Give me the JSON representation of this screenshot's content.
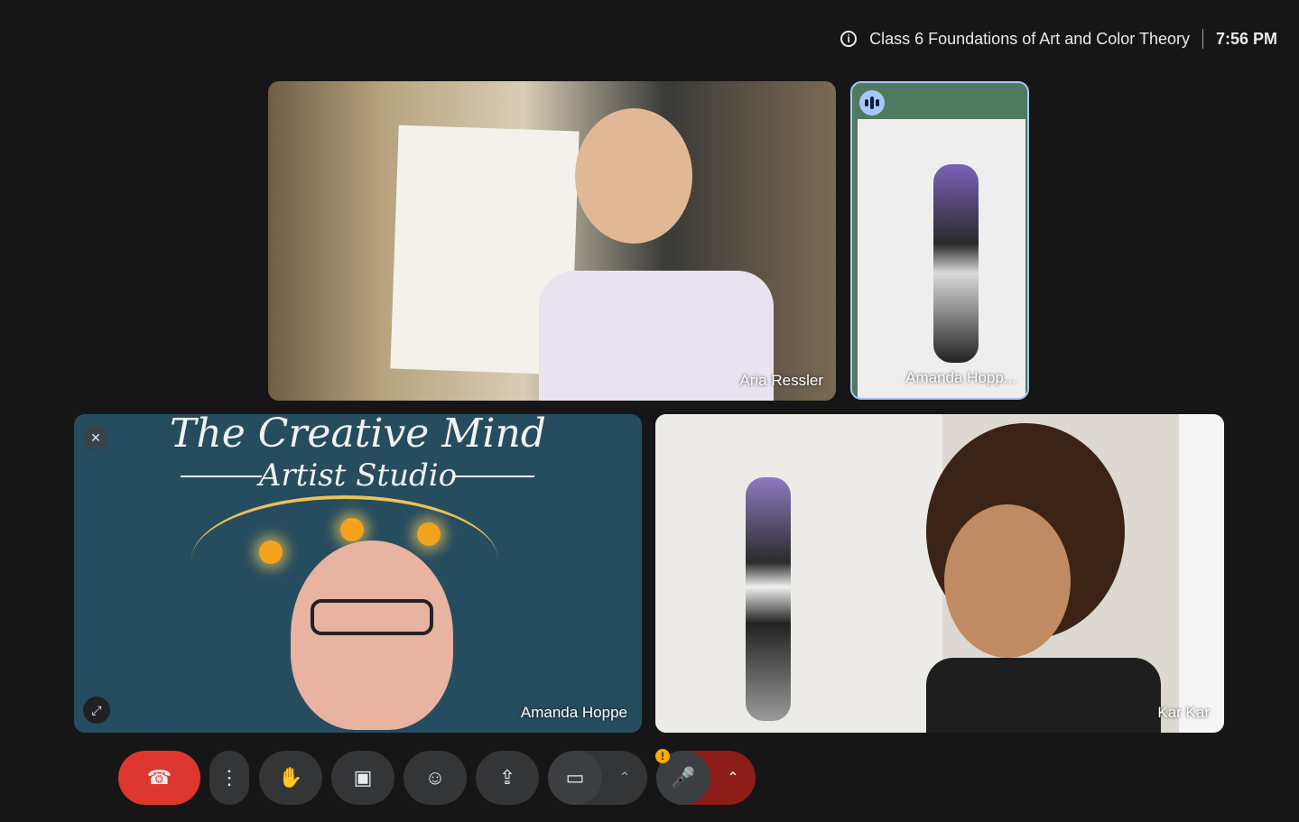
{
  "header": {
    "time": "7:56 PM",
    "meeting_title": "Class 6 Foundations of Art and Color Theory",
    "info_icon": "info-icon"
  },
  "tiles": [
    {
      "name": "Aria Ressler"
    },
    {
      "name": "Amanda Hopp...",
      "speaking": true
    },
    {
      "name": "Amanda Hoppe",
      "muted": true,
      "background_text_1": "The Creative Mind",
      "background_text_2": "Artist Studio"
    },
    {
      "name": "Kar Kar"
    }
  ],
  "controls": {
    "leave_icon": "☎",
    "more_icon": "⋮",
    "hand_icon": "✋",
    "captions_icon": "▣",
    "emoji_icon": "☺",
    "present_icon": "⇪",
    "camera_icon": "▭",
    "camera_chevron": "⌃",
    "mic_icon": "🎤",
    "mic_chevron": "⌃",
    "mic_warning": "!"
  },
  "colors": {
    "leave": "#dc362e",
    "speaking_ring": "#a8c7fa",
    "mic_alert": "#8c1d18",
    "warning": "#f9ab00"
  }
}
